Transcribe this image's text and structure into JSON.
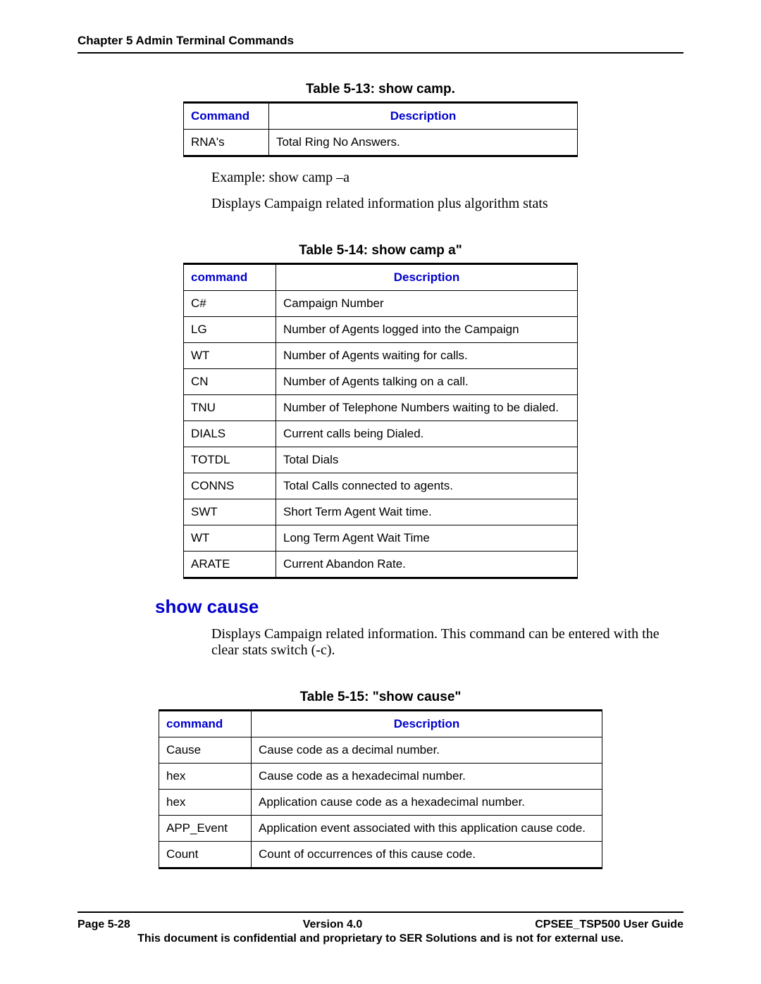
{
  "header": {
    "chapter": "Chapter 5 Admin Terminal Commands"
  },
  "table513": {
    "title": "Table 5-13: show camp.",
    "cols": [
      "Command",
      "Description"
    ],
    "rows": [
      {
        "c": "RNA's",
        "d": "Total Ring No Answers."
      }
    ]
  },
  "text1": "Example:   show camp –a",
  "text2": "Displays Campaign related information plus algorithm stats",
  "table514": {
    "title": "Table 5-14:  show camp a\"",
    "cols": [
      "command",
      "Description"
    ],
    "rows": [
      {
        "c": "C#",
        "d": "Campaign Number"
      },
      {
        "c": "LG",
        "d": "Number of Agents logged into the Campaign"
      },
      {
        "c": "WT",
        "d": "Number of Agents waiting for calls."
      },
      {
        "c": "CN",
        "d": "Number of Agents talking on a call."
      },
      {
        "c": "TNU",
        "d": "Number of Telephone Numbers waiting to be dialed."
      },
      {
        "c": "DIALS",
        "d": "Current calls being Dialed."
      },
      {
        "c": "TOTDL",
        "d": "Total Dials"
      },
      {
        "c": "CONNS",
        "d": "Total Calls connected to agents."
      },
      {
        "c": "SWT",
        "d": "Short Term Agent Wait time."
      },
      {
        "c": "WT",
        "d": "Long Term Agent Wait Time"
      },
      {
        "c": "ARATE",
        "d": "Current Abandon Rate."
      }
    ]
  },
  "sectionHeading": "show cause",
  "text3": "Displays Campaign related information.  This command can be entered with the clear stats switch (-c).",
  "table515": {
    "title": "Table 5-15: \"show cause\"",
    "cols": [
      "command",
      "Description"
    ],
    "rows": [
      {
        "c": "Cause",
        "d": "Cause code as a decimal number."
      },
      {
        "c": "hex",
        "d": "Cause code as a hexadecimal number."
      },
      {
        "c": "hex",
        "d": "Application cause code as a hexadecimal number."
      },
      {
        "c": "APP_Event",
        "d": "Application event associated with this application cause code."
      },
      {
        "c": "Count",
        "d": "Count of occurrences of this cause code."
      }
    ]
  },
  "footer": {
    "left": "Page 5-28",
    "center": "Version 4.0",
    "right": "CPSEE_TSP500 User Guide",
    "note": "This document is confidential and proprietary to SER Solutions and is not for external use."
  }
}
